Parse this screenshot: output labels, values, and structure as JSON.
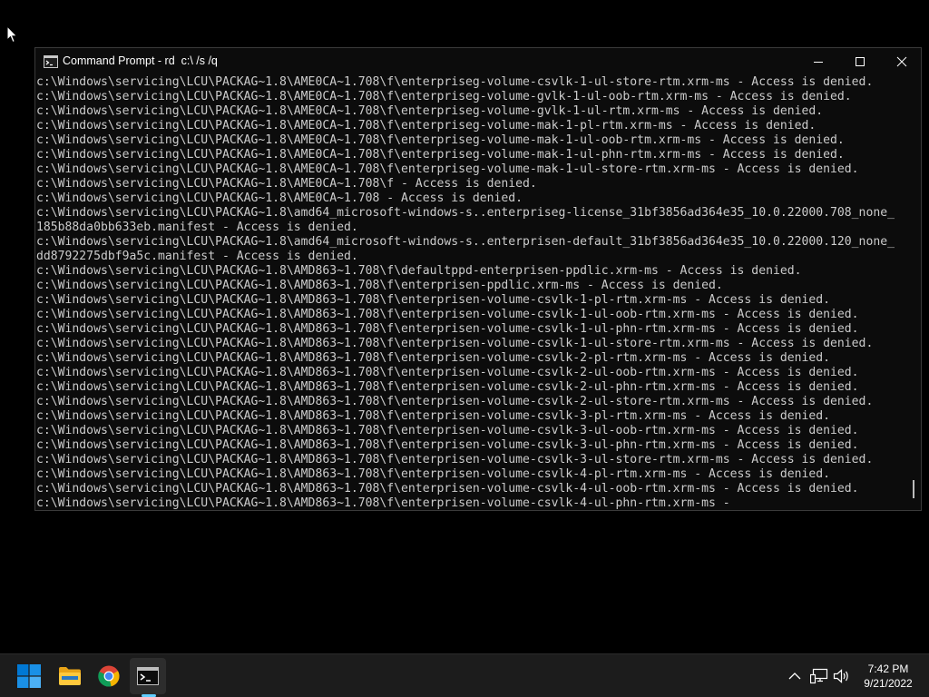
{
  "window": {
    "title": "Command Prompt - rd  c:\\ /s /q"
  },
  "console": {
    "lines": [
      "c:\\Windows\\servicing\\LCU\\PACKAG~1.8\\AME0CA~1.708\\f\\enterpriseg-volume-csvlk-1-ul-store-rtm.xrm-ms - Access is denied.",
      "c:\\Windows\\servicing\\LCU\\PACKAG~1.8\\AME0CA~1.708\\f\\enterpriseg-volume-gvlk-1-ul-oob-rtm.xrm-ms - Access is denied.",
      "c:\\Windows\\servicing\\LCU\\PACKAG~1.8\\AME0CA~1.708\\f\\enterpriseg-volume-gvlk-1-ul-rtm.xrm-ms - Access is denied.",
      "c:\\Windows\\servicing\\LCU\\PACKAG~1.8\\AME0CA~1.708\\f\\enterpriseg-volume-mak-1-pl-rtm.xrm-ms - Access is denied.",
      "c:\\Windows\\servicing\\LCU\\PACKAG~1.8\\AME0CA~1.708\\f\\enterpriseg-volume-mak-1-ul-oob-rtm.xrm-ms - Access is denied.",
      "c:\\Windows\\servicing\\LCU\\PACKAG~1.8\\AME0CA~1.708\\f\\enterpriseg-volume-mak-1-ul-phn-rtm.xrm-ms - Access is denied.",
      "c:\\Windows\\servicing\\LCU\\PACKAG~1.8\\AME0CA~1.708\\f\\enterpriseg-volume-mak-1-ul-store-rtm.xrm-ms - Access is denied.",
      "c:\\Windows\\servicing\\LCU\\PACKAG~1.8\\AME0CA~1.708\\f - Access is denied.",
      "c:\\Windows\\servicing\\LCU\\PACKAG~1.8\\AME0CA~1.708 - Access is denied.",
      "c:\\Windows\\servicing\\LCU\\PACKAG~1.8\\amd64_microsoft-windows-s..enterpriseg-license_31bf3856ad364e35_10.0.22000.708_none_",
      "185b88da0bb633eb.manifest - Access is denied.",
      "c:\\Windows\\servicing\\LCU\\PACKAG~1.8\\amd64_microsoft-windows-s..enterprisen-default_31bf3856ad364e35_10.0.22000.120_none_",
      "dd8792275dbf9a5c.manifest - Access is denied.",
      "c:\\Windows\\servicing\\LCU\\PACKAG~1.8\\AMD863~1.708\\f\\defaultppd-enterprisen-ppdlic.xrm-ms - Access is denied.",
      "c:\\Windows\\servicing\\LCU\\PACKAG~1.8\\AMD863~1.708\\f\\enterprisen-ppdlic.xrm-ms - Access is denied.",
      "c:\\Windows\\servicing\\LCU\\PACKAG~1.8\\AMD863~1.708\\f\\enterprisen-volume-csvlk-1-pl-rtm.xrm-ms - Access is denied.",
      "c:\\Windows\\servicing\\LCU\\PACKAG~1.8\\AMD863~1.708\\f\\enterprisen-volume-csvlk-1-ul-oob-rtm.xrm-ms - Access is denied.",
      "c:\\Windows\\servicing\\LCU\\PACKAG~1.8\\AMD863~1.708\\f\\enterprisen-volume-csvlk-1-ul-phn-rtm.xrm-ms - Access is denied.",
      "c:\\Windows\\servicing\\LCU\\PACKAG~1.8\\AMD863~1.708\\f\\enterprisen-volume-csvlk-1-ul-store-rtm.xrm-ms - Access is denied.",
      "c:\\Windows\\servicing\\LCU\\PACKAG~1.8\\AMD863~1.708\\f\\enterprisen-volume-csvlk-2-pl-rtm.xrm-ms - Access is denied.",
      "c:\\Windows\\servicing\\LCU\\PACKAG~1.8\\AMD863~1.708\\f\\enterprisen-volume-csvlk-2-ul-oob-rtm.xrm-ms - Access is denied.",
      "c:\\Windows\\servicing\\LCU\\PACKAG~1.8\\AMD863~1.708\\f\\enterprisen-volume-csvlk-2-ul-phn-rtm.xrm-ms - Access is denied.",
      "c:\\Windows\\servicing\\LCU\\PACKAG~1.8\\AMD863~1.708\\f\\enterprisen-volume-csvlk-2-ul-store-rtm.xrm-ms - Access is denied.",
      "c:\\Windows\\servicing\\LCU\\PACKAG~1.8\\AMD863~1.708\\f\\enterprisen-volume-csvlk-3-pl-rtm.xrm-ms - Access is denied.",
      "c:\\Windows\\servicing\\LCU\\PACKAG~1.8\\AMD863~1.708\\f\\enterprisen-volume-csvlk-3-ul-oob-rtm.xrm-ms - Access is denied.",
      "c:\\Windows\\servicing\\LCU\\PACKAG~1.8\\AMD863~1.708\\f\\enterprisen-volume-csvlk-3-ul-phn-rtm.xrm-ms - Access is denied.",
      "c:\\Windows\\servicing\\LCU\\PACKAG~1.8\\AMD863~1.708\\f\\enterprisen-volume-csvlk-3-ul-store-rtm.xrm-ms - Access is denied.",
      "c:\\Windows\\servicing\\LCU\\PACKAG~1.8\\AMD863~1.708\\f\\enterprisen-volume-csvlk-4-pl-rtm.xrm-ms - Access is denied.",
      "c:\\Windows\\servicing\\LCU\\PACKAG~1.8\\AMD863~1.708\\f\\enterprisen-volume-csvlk-4-ul-oob-rtm.xrm-ms - Access is denied.",
      "c:\\Windows\\servicing\\LCU\\PACKAG~1.8\\AMD863~1.708\\f\\enterprisen-volume-csvlk-4-ul-phn-rtm.xrm-ms - "
    ]
  },
  "taskbar": {
    "apps": [
      {
        "name": "start",
        "icon": "windows-logo-icon"
      },
      {
        "name": "file-explorer",
        "icon": "folder-icon"
      },
      {
        "name": "chrome",
        "icon": "chrome-icon"
      },
      {
        "name": "command-prompt",
        "icon": "terminal-icon",
        "active": true
      }
    ],
    "tray": {
      "icons": [
        "chevron-up-icon",
        "network-icon",
        "volume-icon"
      ]
    },
    "clock": {
      "time": "7:42 PM",
      "date": "9/21/2022"
    }
  },
  "colors": {
    "console_background": "#0c0c0c",
    "console_text": "#cccccc",
    "taskbar_background": "#1c1c1c",
    "active_indicator": "#60cdff"
  }
}
